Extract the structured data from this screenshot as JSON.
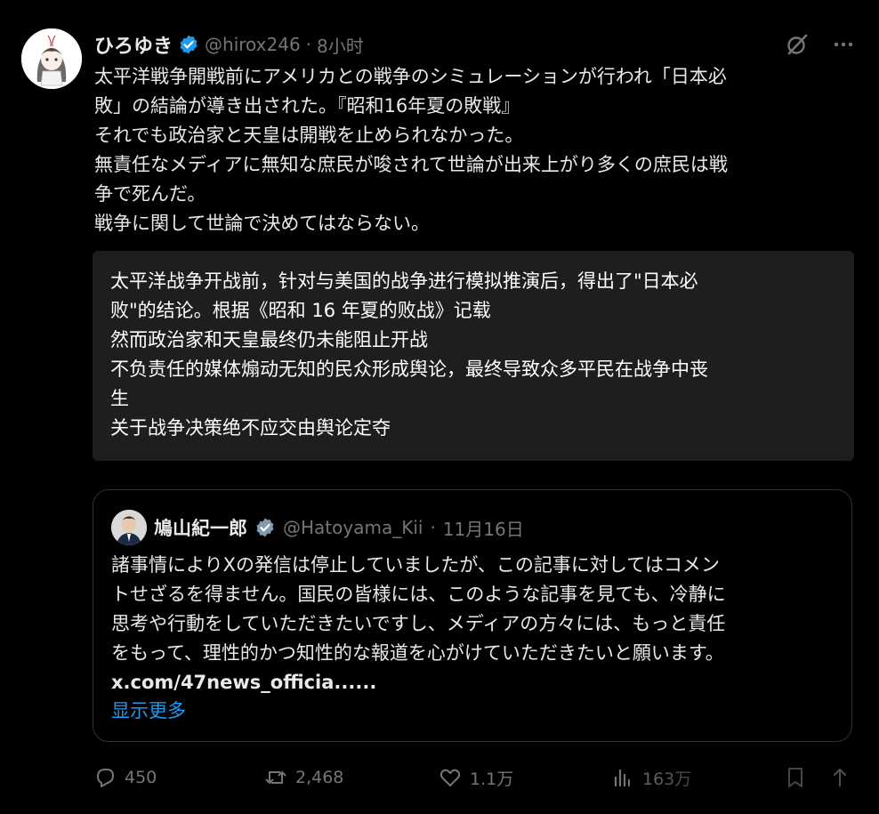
{
  "author": {
    "name": "ひろゆき",
    "handle": "@hirox246",
    "separator": "·",
    "time": "8小时",
    "avatar_icon": "avatar-anime-girl-icon"
  },
  "tweet_text": "太平洋戦争開戦前にアメリカとの戦争のシミュレーションが行われ「日本必\n敗」の結論が導き出された。『昭和16年夏の敗戦』\nそれでも政治家と天皇は開戦を止められなかった。\n無責任なメディアに無知な庶民が唆されて世論が出来上がり多くの庶民は戦\n争で死んだ。\n戦争に関して世論で決めてはならない。",
  "translation": "太平洋战争开战前，针对与美国的战争进行模拟推演后，得出了\"日本必\n败\"的结论。根据《昭和 16 年夏的败战》记载\n然而政治家和天皇最终仍未能阻止开战\n不负责任的媒体煽动无知的民众形成舆论，最终导致众多平民在战争中丧\n生\n关于战争决策绝不应交由舆论定夺",
  "quote": {
    "name": "鳩山紀一郎",
    "handle": "@Hatoyama_Kii",
    "separator": "·",
    "date": "11月16日",
    "text": "諸事情によりXの発信は停止していましたが、この記事に対してはコメン\nトせざるを得ません。国民の皆様には、このような記事を見ても、冷静に\n思考や行動をしていただきたいですし、メディアの方々には、もっと責任\nをもって、理性的かつ知性的な報道を心がけていただきたいと願います。",
    "link": "x.com/47news_officia......",
    "show_more": "显示更多"
  },
  "actions": {
    "reply_count": "450",
    "repost_count": "2,468",
    "like_count": "1.1万",
    "view_count": "163万"
  },
  "colors": {
    "background": "#000000",
    "text": "#e7e9ea",
    "muted": "#71767b",
    "accent": "#1d9bf0",
    "translation_bg": "#1f1d1d"
  }
}
